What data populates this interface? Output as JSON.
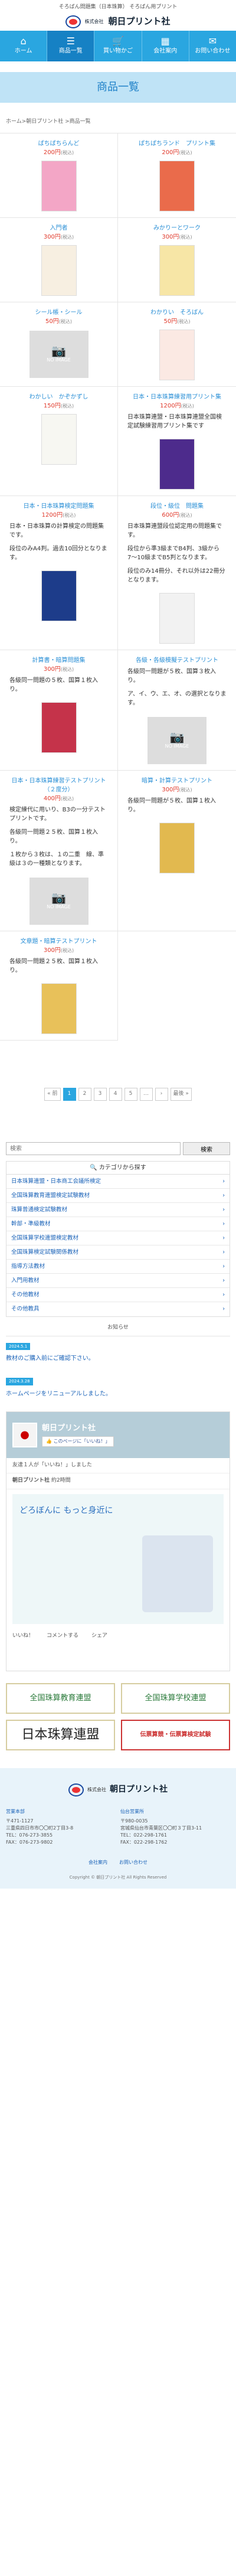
{
  "header": {
    "tagline": "そろばん問題集（日本珠算） そろばん用プリント",
    "company_small": "株式会社",
    "company_name": "朝日プリント社"
  },
  "nav": [
    {
      "label": "ホーム",
      "icon": "home-icon",
      "glyph": "⌂"
    },
    {
      "label": "商品一覧",
      "icon": "list-icon",
      "glyph": "☰"
    },
    {
      "label": "買い物かご",
      "icon": "cart-icon",
      "glyph": "🛒"
    },
    {
      "label": "会社案内",
      "icon": "building-icon",
      "glyph": "▦"
    },
    {
      "label": "お問い合わせ",
      "icon": "mail-icon",
      "glyph": "✉"
    }
  ],
  "page_title": "商品一覧",
  "breadcrumb": "ホーム>朝日プリント社 >商品一覧",
  "tax_note": "(税込)",
  "no_image": "NO IMAGE",
  "products": [
    {
      "title": "ぱちぱちらんど",
      "price": "200円",
      "kind": "thumb",
      "color": "#f3a6c6"
    },
    {
      "title": "ぱちぱちランド　プリント集",
      "price": "200円",
      "kind": "thumb",
      "color": "#ea6b4b"
    },
    {
      "title": "入門者",
      "price": "300円",
      "kind": "thumb",
      "color": "#f7efe1"
    },
    {
      "title": "みかりーとワーク",
      "price": "300円",
      "kind": "thumb",
      "color": "#f7e6a6"
    },
    {
      "title": "シール帳・シール",
      "price": "50円",
      "kind": "noimage"
    },
    {
      "title": "わかりい　そろばん",
      "price": "50円",
      "kind": "thumb",
      "color": "#fbe9e3"
    },
    {
      "title": "わかしい　かぞかずし",
      "price": "150円",
      "kind": "thumb",
      "color": "#f7f7f2"
    },
    {
      "title": "日本・日本珠算練習用プリント集",
      "price": "1200円",
      "kind": "desc",
      "desc": [
        "日本珠算連盟・日本珠算連盟全国検定試験練習用プリント集です"
      ],
      "color": "#4d2b8c"
    },
    {
      "title": "日本・日本珠算検定問題集",
      "price": "1200円",
      "kind": "desc",
      "desc": [
        "日本・日本珠算の計算検定の問題集です。",
        "段位のみA4判。過去10回分となります。"
      ],
      "color": "#1d3c8a"
    },
    {
      "title": "段位・級位　問題集",
      "price": "600円",
      "kind": "desc",
      "desc": [
        "日本珠算連盟段位認定用の問題集です。",
        "段位から準3級までB4判、3級から7〜10級までB5判となります。",
        "段位のみ14冊分、それ以外は22冊分となります。"
      ],
      "color": "#f2f2f2"
    },
    {
      "title": "計算書・暗算問題集",
      "price": "300円",
      "kind": "desc",
      "desc": [
        "各級同一問題の５枚、国算１枚入り。"
      ],
      "color": "#c5334a"
    },
    {
      "title": "各級・各級模擬テストプリント",
      "price": "",
      "kind": "descnop",
      "desc": [
        "各級同一問題が５枚、国算３枚入り。",
        "ア、イ、ウ、エ、オ、の選択となります。"
      ]
    },
    {
      "title": "日本・日本珠算練習テストプリント（２度分）",
      "price": "400円",
      "kind": "descnop",
      "desc": [
        "検定練代に用いり、B3の一分テストプリントです。",
        "各級同一問題２５枚、国算１枚入り。",
        "１枚から３枚は、１の二重　線、準級は３の一種類となります。"
      ]
    },
    {
      "title": "暗算・計算テストプリント",
      "price": "300円",
      "kind": "desc",
      "desc": [
        "各級同一問題が５枚、国算１枚入り。"
      ],
      "color": "#e2b94f"
    },
    {
      "title": "文章題・暗算テストプリント",
      "price": "300円",
      "kind": "desc",
      "desc": [
        "各級同一問題２５枚、国算１枚入り。"
      ],
      "color": "#e8c15a"
    }
  ],
  "pager": {
    "prev": "« 前",
    "pages": [
      "1",
      "2",
      "3",
      "4",
      "5"
    ],
    "ellipsis": "…",
    "next": "›",
    "last": "最後 »"
  },
  "search": {
    "placeholder": "検索",
    "button": "検索"
  },
  "categories": {
    "heading": "カテゴリから探す",
    "items": [
      "日本珠算連盟・日本商工会議所検定",
      "全国珠算教育連盟検定試験教材",
      "珠算普通検定試験教材",
      "幹部・準級教材",
      "全国珠算学校連盟検定教材",
      "全国珠算検定試験関係教材",
      "指導方法教材",
      "入門用教材",
      "その他教材",
      "その他教具"
    ]
  },
  "news": {
    "heading": "お知らせ",
    "items": [
      {
        "date": "2024.5.1",
        "text": "教材のご購入前にご確認下さい。"
      },
      {
        "date": "2024.3.28",
        "text": "ホームページをリニューアルしました。"
      }
    ]
  },
  "fb": {
    "page_name": "朝日プリント社",
    "like_label": "このページに「いいね！」",
    "friends_text": "友達１人が「いいね！」しました",
    "post_text": "どろぼんに もっと身近に",
    "post_author": "朝日プリント社",
    "post_time": "約2時間",
    "actions": [
      "いいね！",
      "コメントする",
      "シェア"
    ]
  },
  "banners": [
    "全国珠算教育連盟",
    "全国珠算学校連盟",
    "日本珠算連盟",
    "伝票算競・伝票算検定試験"
  ],
  "footer": {
    "company_small": "株式会社",
    "company_name": "朝日プリント社",
    "col1_title": "営業本部",
    "col1_lines": [
      "〒471-1127",
      "三重県四日市市〇〇町2丁目3-8",
      "TEL：076-273-3855",
      "FAX：076-273-9802"
    ],
    "col2_title": "仙台営業所",
    "col2_lines": [
      "〒980-0035",
      "宮城県仙台市青葉区〇〇町３丁目3-11",
      "TEL：022-298-1761",
      "FAX：022-298-1762"
    ],
    "links": [
      "会社案内",
      "お問い合わせ"
    ],
    "copyright": "Copyright © 朝日プリント社 All Rights Reserved"
  }
}
